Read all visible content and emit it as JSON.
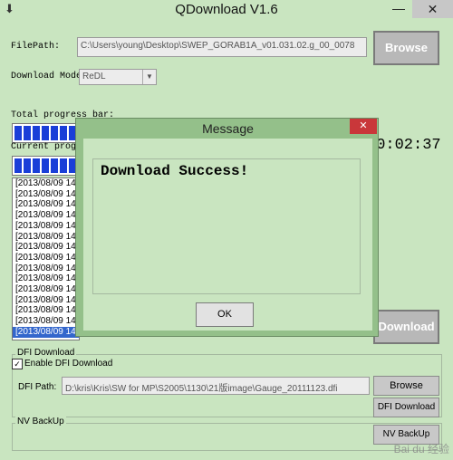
{
  "window": {
    "title": "QDownload V1.6",
    "minimize_glyph": "—",
    "close_glyph": "✕"
  },
  "filepath": {
    "label": "FilePath:",
    "value": "C:\\Users\\young\\Desktop\\SWEP_GORAB1A_v01.031.02.g_00_0078",
    "browse_label": "Browse"
  },
  "download_mode": {
    "label": "Download Mode:",
    "selected": "ReDL"
  },
  "progress": {
    "total_label": "Total progress bar:",
    "current_label": "Current progre",
    "total_fraction": 0.16,
    "current_fraction": 0.16,
    "timer": "00:02:37"
  },
  "log": {
    "lines": [
      "[2013/08/09 14:",
      "[2013/08/09 14:",
      "[2013/08/09 14:",
      "[2013/08/09 14:",
      "[2013/08/09 14:",
      "[2013/08/09 14:",
      "[2013/08/09 14:",
      "[2013/08/09 14:",
      "[2013/08/09 14:",
      "[2013/08/09 14:",
      "[2013/08/09 14:",
      "[2013/08/09 14:",
      "[2013/08/09 14:",
      "[2013/08/09 14:",
      "[2013/08/09 14:"
    ]
  },
  "download_button": {
    "label": "Download"
  },
  "dfi": {
    "group_title": "DFI Download",
    "enable_label": "Enable DFI Download",
    "enabled": true,
    "path_label": "DFI Path:",
    "path_value": "D:\\kris\\Kris\\SW for MP\\S2005\\1130\\21版image\\Gauge_20111123.dfi",
    "browse_label": "Browse",
    "download_label": "DFI Download"
  },
  "nv": {
    "group_title": "NV BackUp",
    "button_label": "NV BackUp"
  },
  "dialog": {
    "title": "Message",
    "message": "Download Success!",
    "ok_label": "OK",
    "close_glyph": "✕"
  },
  "watermark": "Bai du 经验",
  "colors": {
    "background": "#c9e5c0",
    "progress_fill": "#1a3fd8",
    "dialog_frame": "#94c08a",
    "close_red": "#c9373a"
  }
}
